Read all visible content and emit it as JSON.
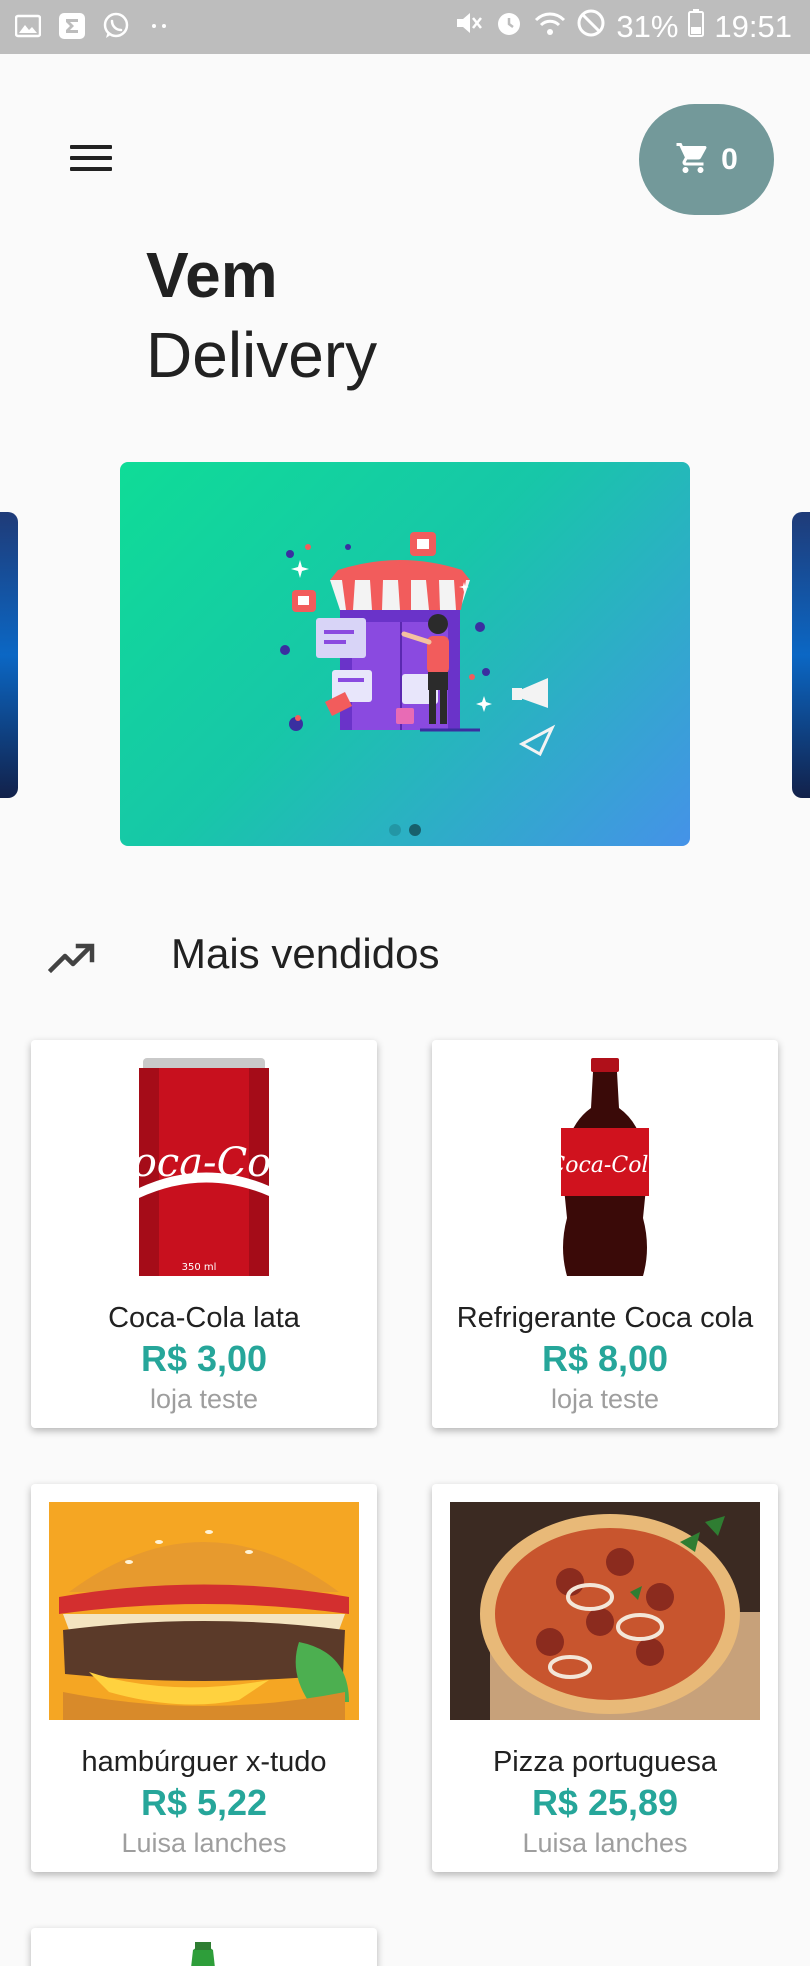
{
  "status_bar": {
    "battery": "31%",
    "time": "19:51",
    "icons": [
      "gallery-icon",
      "sigma-icon",
      "whatsapp-icon",
      "more-dots-icon",
      "mute-icon",
      "alarm-icon",
      "wifi-icon",
      "block-icon",
      "battery-icon"
    ]
  },
  "header": {
    "menu_icon": "menu-icon",
    "cart_icon": "cart-icon",
    "cart_count": "0"
  },
  "brand": {
    "line1": "Vem",
    "line2": "Delivery"
  },
  "carousel": {
    "active_index": 1,
    "dots": 2
  },
  "section": {
    "icon": "trending-up-icon",
    "title": "Mais vendidos"
  },
  "products": [
    {
      "name": "Coca-Cola lata",
      "price": "R$ 3,00",
      "store": "loja teste",
      "image": "coca-cola-can"
    },
    {
      "name": "Refrigerante Coca cola",
      "price": "R$ 8,00",
      "store": "loja teste",
      "image": "coca-cola-bottle"
    },
    {
      "name": "hambúrguer x-tudo",
      "price": "R$ 5,22",
      "store": "Luisa lanches",
      "image": "hamburger"
    },
    {
      "name": "Pizza portuguesa",
      "price": "R$ 25,89",
      "store": "Luisa lanches",
      "image": "pizza"
    }
  ],
  "colors": {
    "accent": "#26a69a",
    "cart_button": "#73999a",
    "status_bar": "#bdbdbd"
  }
}
